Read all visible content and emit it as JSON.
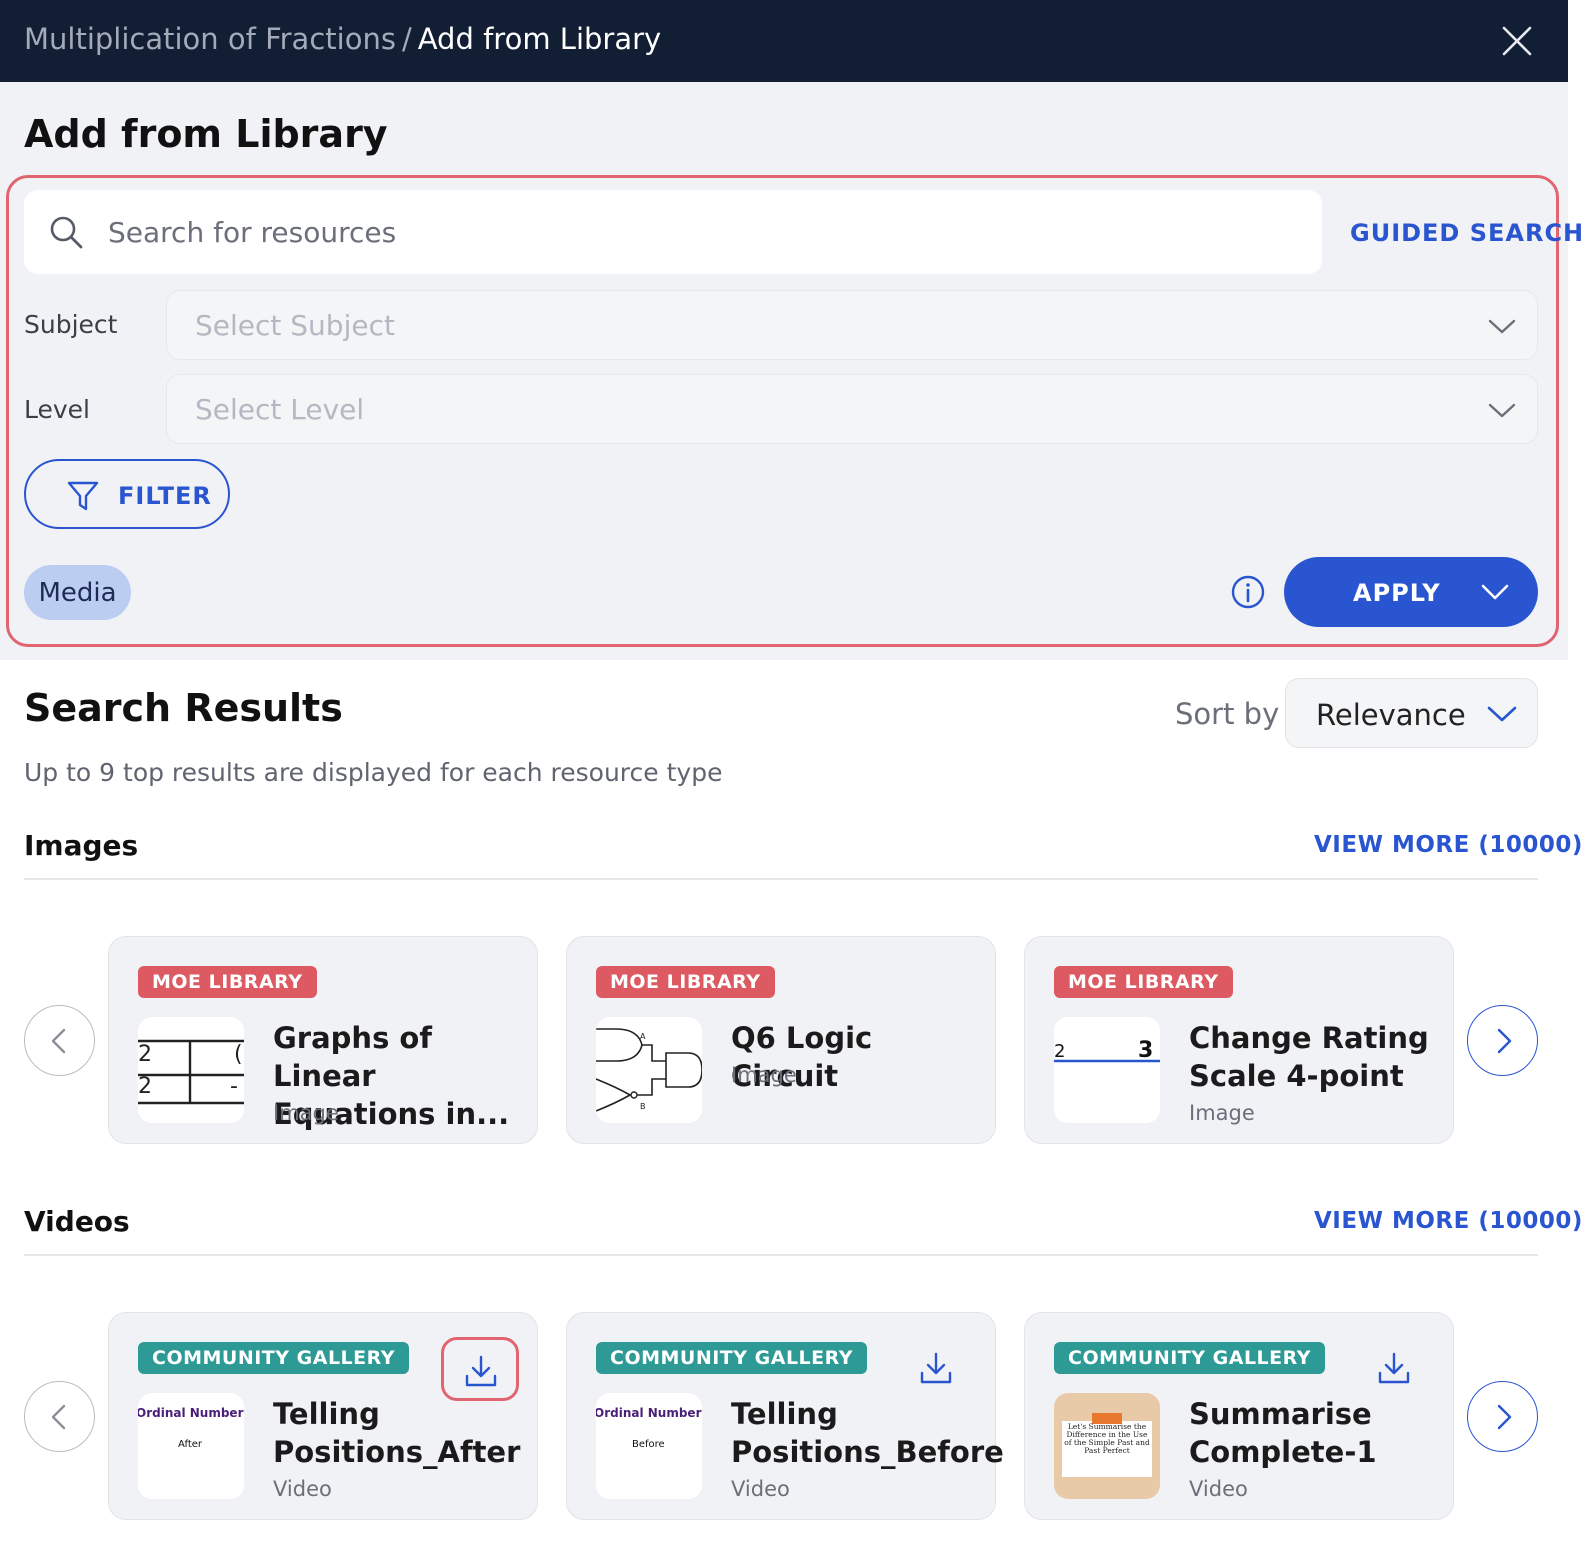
{
  "header": {
    "breadcrumb_parent": "Multiplication of Fractions",
    "breadcrumb_sep": "/",
    "breadcrumb_current": "Add from Library"
  },
  "page_title": "Add from Library",
  "search": {
    "placeholder": "Search for resources",
    "value": "",
    "guided_label": "GUIDED SEARCH"
  },
  "filters": {
    "subject_label": "Subject",
    "subject_placeholder": "Select Subject",
    "level_label": "Level",
    "level_placeholder": "Select Level",
    "filter_button": "FILTER",
    "chip": "Media",
    "apply_label": "APPLY"
  },
  "results": {
    "title": "Search Results",
    "subtitle": "Up to 9 top results are displayed for each resource type",
    "sort_label": "Sort by",
    "sort_value": "Relevance"
  },
  "images": {
    "title": "Images",
    "view_more": "VIEW MORE (10000)",
    "cards": [
      {
        "badge": "MOE LIBRARY",
        "title": "Graphs of Linear Equations in...",
        "type": "Image"
      },
      {
        "badge": "MOE LIBRARY",
        "title": "Q6 Logic Circuit",
        "type": "Image"
      },
      {
        "badge": "MOE LIBRARY",
        "title": "Change Rating Scale 4-point",
        "type": "Image"
      }
    ]
  },
  "videos": {
    "title": "Videos",
    "view_more": "VIEW MORE (10000)",
    "cards": [
      {
        "badge": "COMMUNITY GALLERY",
        "title": "Telling Positions_After",
        "type": "Video",
        "thumb_heading": "Ordinal Numbers",
        "thumb_caption": "After"
      },
      {
        "badge": "COMMUNITY GALLERY",
        "title": "Telling Positions_Before",
        "type": "Video",
        "thumb_heading": "Ordinal Numbers",
        "thumb_caption": "Before"
      },
      {
        "badge": "COMMUNITY GALLERY",
        "title": "Summarise Complete-1",
        "type": "Video",
        "thumb_caption": "Let's Summarise the Difference in the Use of the Simple Past and Past Perfect"
      }
    ]
  },
  "colors": {
    "header_bg": "#121e34",
    "accent": "#2a55d0",
    "moe_badge": "#dd5a63",
    "community_badge": "#2e9a96",
    "highlight": "#e06570"
  }
}
